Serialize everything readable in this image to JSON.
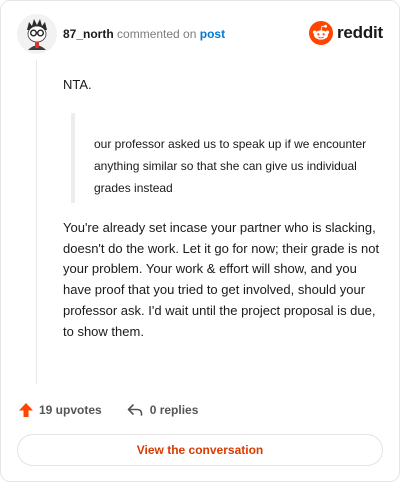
{
  "header": {
    "username": "87_north",
    "action_text": "commented on",
    "post_link": "post",
    "brand": "reddit"
  },
  "comment": {
    "paragraph_1": "NTA.",
    "quote": "our professor asked us to speak up if we encounter anything similar so that she can give us individual grades instead",
    "paragraph_2": "You're already set incase your partner who is slacking, doesn't do the work. Let it go for now; their grade is not your problem. Your work & effort will show, and you have proof that you tried to get involved, should your professor ask. I'd wait until the project proposal is due, to show them."
  },
  "actions": {
    "upvotes_label": "19 upvotes",
    "replies_label": "0 replies"
  },
  "footer": {
    "view_button_label": "View the conversation"
  },
  "colors": {
    "brand_orange": "#ff4500",
    "link_blue": "#0079d3",
    "button_text": "#d93a00"
  },
  "icons": {
    "avatar": "avatar-icon",
    "logo": "reddit-logo-icon",
    "upvote": "upvote-arrow-icon",
    "reply": "reply-arrow-icon"
  }
}
